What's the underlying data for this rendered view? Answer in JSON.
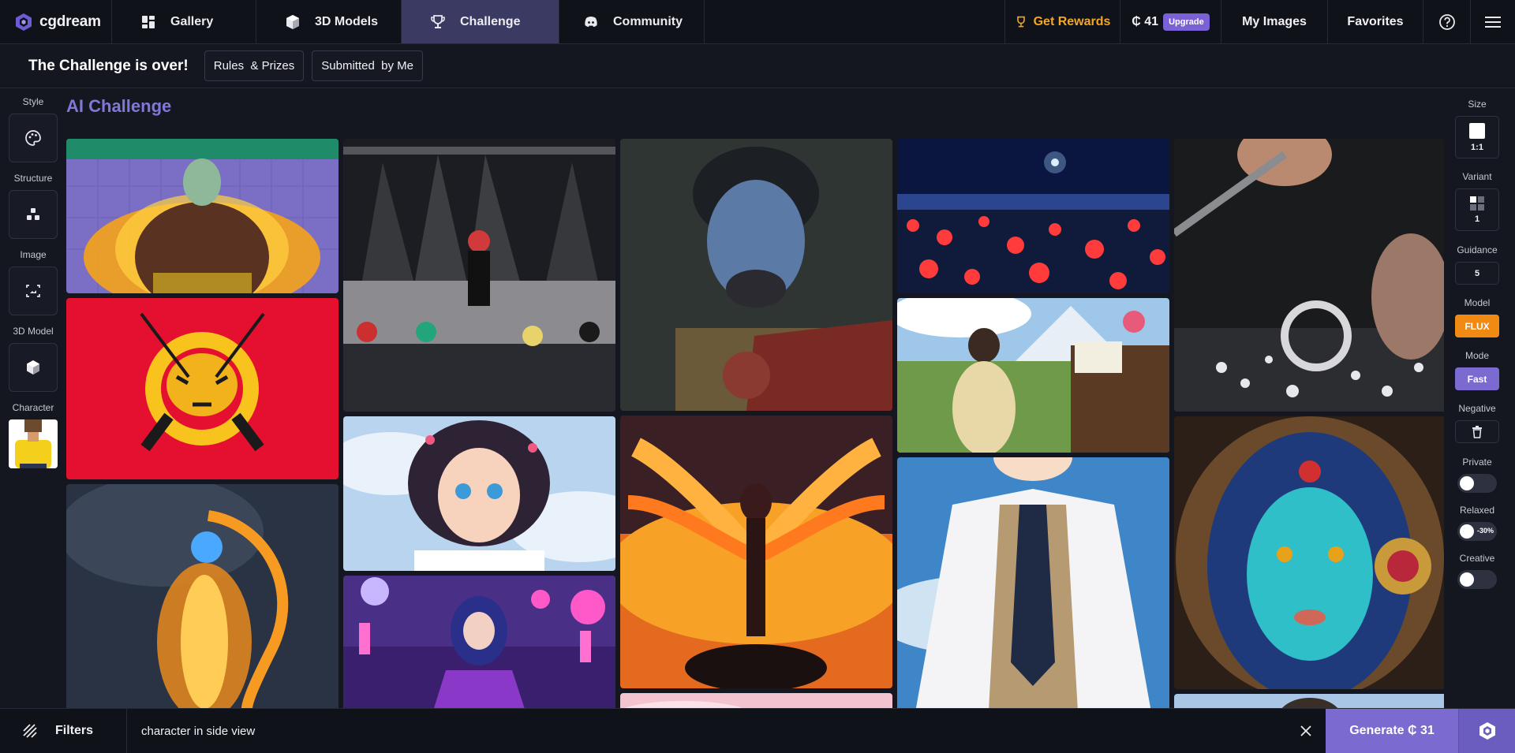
{
  "brand": {
    "name": "cgdream"
  },
  "nav": {
    "tabs": [
      {
        "label": "Gallery",
        "icon": "grid-icon"
      },
      {
        "label": "3D Models",
        "icon": "cube-icon"
      },
      {
        "label": "Challenge",
        "icon": "trophy-icon",
        "active": true
      },
      {
        "label": "Community",
        "icon": "discord-icon"
      }
    ],
    "rewards_label": "Get Rewards",
    "credits_value": "₵ 41",
    "upgrade_label": "Upgrade",
    "my_images_label": "My Images",
    "favorites_label": "Favorites"
  },
  "subheader": {
    "title": "The Challenge is over!",
    "rules_label": "Rules  & Prizes",
    "submitted_label": "Submitted  by Me"
  },
  "left_rail": {
    "style_label": "Style",
    "structure_label": "Structure",
    "image_label": "Image",
    "model3d_label": "3D Model",
    "character_label": "Character"
  },
  "page": {
    "heading": "AI Challenge"
  },
  "right_rail": {
    "size_label": "Size",
    "size_value": "1:1",
    "variant_label": "Variant",
    "variant_value": "1",
    "guidance_label": "Guidance",
    "guidance_value": "5",
    "model_label": "Model",
    "model_value": "FLUX",
    "mode_label": "Mode",
    "mode_value": "Fast",
    "negative_label": "Negative",
    "private_label": "Private",
    "relaxed_label": "Relaxed",
    "relaxed_badge": "-30%",
    "creative_label": "Creative"
  },
  "bottom": {
    "filters_label": "Filters",
    "prompt_value": "character in side view",
    "generate_label": "Generate ₵ 31"
  },
  "colors": {
    "accent": "#7b6ad0",
    "rewards": "#f5a623",
    "model_chip": "#f08a12",
    "heading": "#7f78d9"
  }
}
